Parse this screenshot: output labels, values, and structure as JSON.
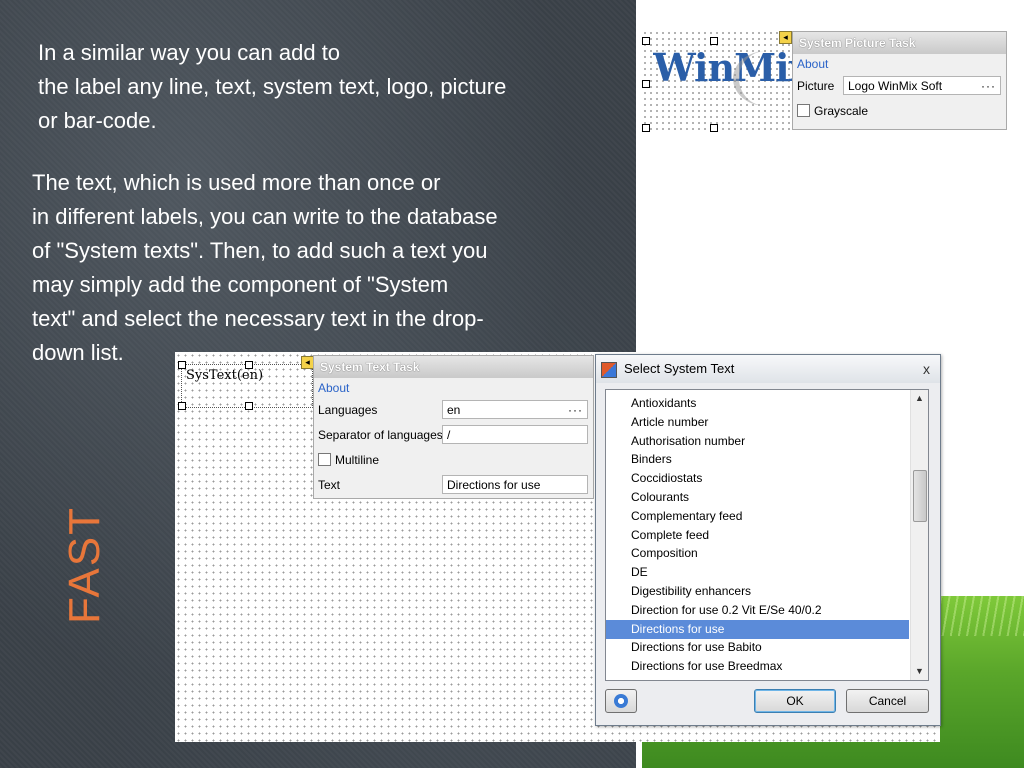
{
  "slide": {
    "para1": [
      "In a similar way you can add to",
      "the label any line, text, system text, logo, picture",
      "or bar-code."
    ],
    "para2": [
      "The text, which is used more than once or",
      "in different labels, you can write to the database",
      "of \"System texts\". Then, to add such a text you",
      "may simply add the component of \"System",
      "text\" and select the necessary text in the drop-",
      "down list."
    ],
    "side_title": "FAST",
    "accent_color": "#e8763a"
  },
  "picture_task": {
    "logo_text": "WinMix Soft",
    "title": "System Picture Task",
    "about": "About",
    "picture_label": "Picture",
    "picture_value": "Logo WinMix Soft",
    "ellipsis": "···",
    "grayscale_label": "Grayscale"
  },
  "text_task": {
    "component_label": "SysText(en)",
    "title": "System Text Task",
    "about": "About",
    "languages_label": "Languages",
    "languages_value": "en",
    "ellipsis": "···",
    "separator_label": "Separator of languages",
    "separator_value": "/",
    "multiline_label": "Multiline",
    "text_label": "Text",
    "text_value": "Directions for use"
  },
  "dialog": {
    "title": "Select System Text",
    "close": "x",
    "items": [
      "Antioxidants",
      "Article number",
      "Authorisation number",
      "Binders",
      "Coccidiostats",
      "Colourants",
      "Complementary feed",
      "Complete feed",
      "Composition",
      "DE",
      "Digestibility enhancers",
      "Direction for use 0.2 Vit E/Se 40/0.2",
      "Directions for use",
      "Directions for use Babito",
      "Directions for use Breedmax"
    ],
    "selected_item": "Directions for use",
    "ok_label": "OK",
    "cancel_label": "Cancel",
    "refresh_icon": "refresh-icon"
  }
}
